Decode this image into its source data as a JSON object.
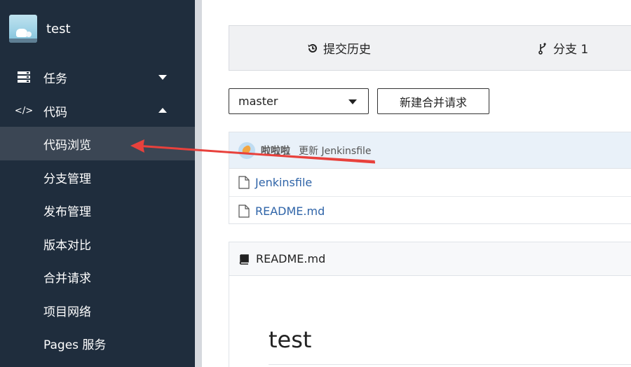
{
  "sidebar": {
    "repo_name": "test",
    "menu": [
      {
        "label": "任务",
        "icon": "tasks-icon",
        "expanded": false
      },
      {
        "label": "代码",
        "icon": "code-icon",
        "expanded": true
      }
    ],
    "code_submenu": [
      {
        "label": "代码浏览",
        "active": true
      },
      {
        "label": "分支管理"
      },
      {
        "label": "发布管理"
      },
      {
        "label": "版本对比"
      },
      {
        "label": "合并请求"
      },
      {
        "label": "项目网络"
      },
      {
        "label": "Pages 服务"
      }
    ]
  },
  "main": {
    "tabs": [
      {
        "label": "提交历史",
        "icon": "history-icon"
      },
      {
        "label": "分支 1",
        "icon": "branch-icon"
      }
    ],
    "branch_select": {
      "value": "master"
    },
    "new_merge_request_label": "新建合并请求",
    "latest_commit": {
      "author": "啦啦啦",
      "message": "更新 Jenkinsfile"
    },
    "files": [
      {
        "name": "Jenkinsfile",
        "icon": "file-icon"
      },
      {
        "name": "README.md",
        "icon": "file-icon"
      }
    ],
    "readme": {
      "title": "README.md",
      "icon": "book-icon",
      "heading": "test"
    }
  },
  "colors": {
    "sidebar_bg": "#1f2d3d",
    "sidebar_active_bg": "#3b4654",
    "link": "#2f64a8",
    "commit_row_bg": "#e9f1f9",
    "annotation_arrow": "#e8413c"
  }
}
